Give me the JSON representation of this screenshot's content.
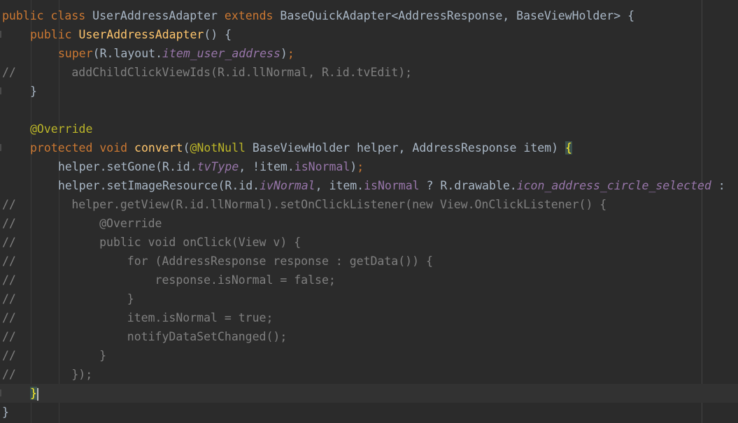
{
  "editor": {
    "theme_colors": {
      "background": "#2b2b2b",
      "current_line": "#323232",
      "keyword": "#cc7832",
      "method": "#ffc66d",
      "field": "#9876aa",
      "annotation": "#bbb529",
      "comment": "#808080",
      "text": "#a9b7c6"
    },
    "lines": [
      {
        "text": "public class UserAddressAdapter extends BaseQuickAdapter<AddressResponse, BaseViewHolder> {"
      },
      {
        "text": "    public UserAddressAdapter() {"
      },
      {
        "text": "        super(R.layout.item_user_address);"
      },
      {
        "text": "//        addChildClickViewIds(R.id.llNormal, R.id.tvEdit);"
      },
      {
        "text": "    }"
      },
      {
        "text": ""
      },
      {
        "text": "    @Override"
      },
      {
        "text": "    protected void convert(@NotNull BaseViewHolder helper, AddressResponse item) {"
      },
      {
        "text": "        helper.setGone(R.id.tvType, !item.isNormal);"
      },
      {
        "text": "        helper.setImageResource(R.id.ivNormal, item.isNormal ? R.drawable.icon_address_circle_selected :"
      },
      {
        "text": "//        helper.getView(R.id.llNormal).setOnClickListener(new View.OnClickListener() {"
      },
      {
        "text": "//            @Override"
      },
      {
        "text": "//            public void onClick(View v) {"
      },
      {
        "text": "//                for (AddressResponse response : getData()) {"
      },
      {
        "text": "//                    response.isNormal = false;"
      },
      {
        "text": "//                }"
      },
      {
        "text": "//                item.isNormal = true;"
      },
      {
        "text": "//                notifyDataSetChanged();"
      },
      {
        "text": "//            }"
      },
      {
        "text": "//        });"
      },
      {
        "text": "    }"
      },
      {
        "text": "}"
      }
    ],
    "tokens": {
      "l0": [
        "public",
        "class",
        "UserAddressAdapter",
        "extends",
        "BaseQuickAdapter<AddressResponse, BaseViewHolder> {"
      ],
      "l1": [
        "public",
        "UserAddressAdapter",
        "() {"
      ],
      "l2": [
        "super",
        "(R.layout.",
        "item_user_address",
        ")",
        ";"
      ],
      "l3": [
        "//        addChildClickViewIds(R.id.llNormal, R.id.tvEdit);"
      ],
      "l4": [
        "}"
      ],
      "l6": [
        "@Override"
      ],
      "l7": [
        "protected",
        "void",
        "convert",
        "(",
        "@NotNull",
        " BaseViewHolder helper, AddressResponse item) ",
        "{"
      ],
      "l8": [
        "helper.setGone(R.id.",
        "tvType",
        ", !item.",
        "isNormal",
        ")",
        ";"
      ],
      "l9": [
        "helper.setImageResource(R.id.",
        "ivNormal",
        ", item.",
        "isNormal",
        " ? R.drawable.",
        "icon_address_circle_selected",
        " :"
      ],
      "l10": [
        "//        helper.getView(R.id.llNormal).setOnClickListener(new View.OnClickListener() {"
      ],
      "l11": [
        "//            @Override"
      ],
      "l12": [
        "//            public void onClick(View v) {"
      ],
      "l13": [
        "//                for (AddressResponse response : getData()) {"
      ],
      "l14": [
        "//                    response.isNormal = false;"
      ],
      "l15": [
        "//                }"
      ],
      "l16": [
        "//                item.isNormal = true;"
      ],
      "l17": [
        "//                notifyDataSetChanged();"
      ],
      "l18": [
        "//            }"
      ],
      "l19": [
        "//        });"
      ],
      "l20": [
        "}"
      ],
      "l21": [
        "}"
      ]
    }
  }
}
